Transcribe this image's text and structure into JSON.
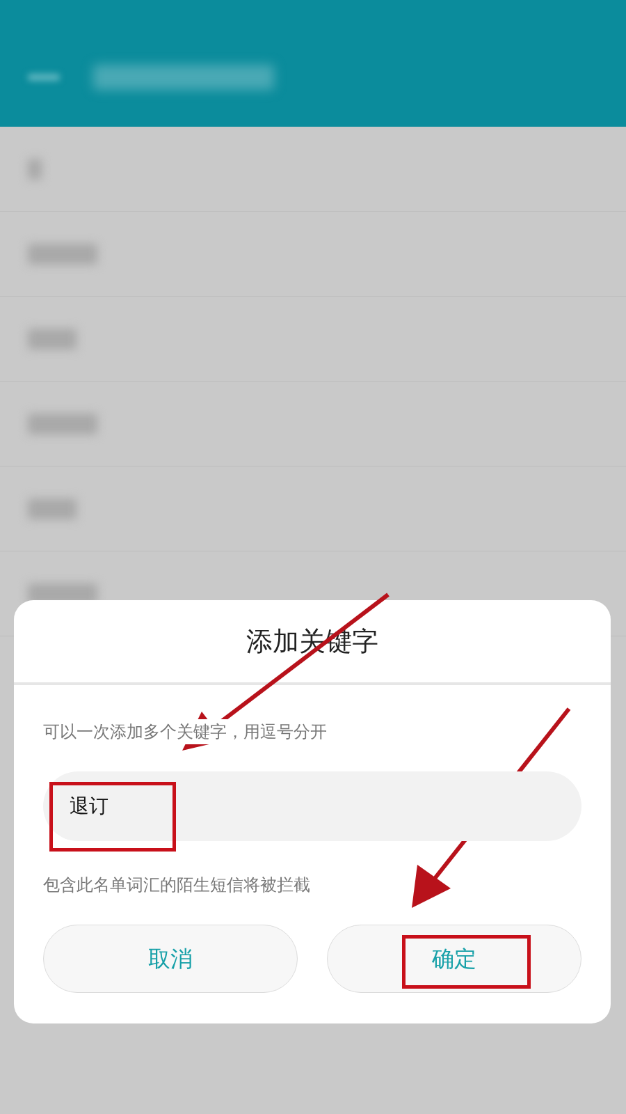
{
  "dialog": {
    "title": "添加关键字",
    "hint": "可以一次添加多个关键字，用逗号分开",
    "field": {
      "value": "退订"
    },
    "note": "包含此名单词汇的陌生短信将被拦截",
    "buttons": [
      {
        "label": "取消"
      },
      {
        "label": "确定"
      }
    ]
  }
}
